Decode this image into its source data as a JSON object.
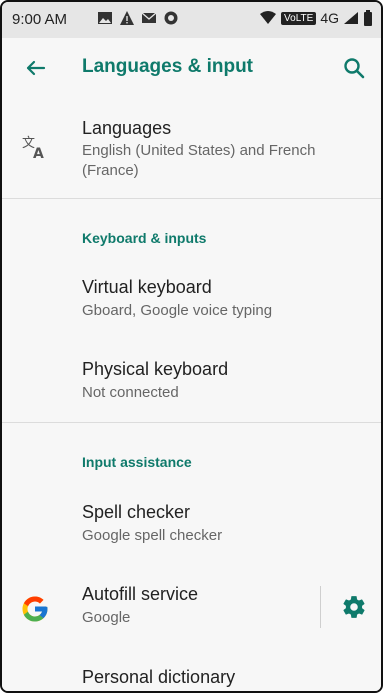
{
  "status_bar": {
    "time": "9:00 AM",
    "icons_left": [
      "image-icon",
      "warning-icon",
      "mail-icon",
      "shield-icon"
    ],
    "volte": "VoLTE",
    "network": "4G",
    "icons_right": [
      "wifi-icon",
      "signal-icon",
      "battery-icon"
    ]
  },
  "app_bar": {
    "title": "Languages & input",
    "back_icon": "arrow-back-icon",
    "search_icon": "search-icon",
    "accent": "#0f7a6b"
  },
  "items": [
    {
      "id": "languages",
      "title": "Languages",
      "summary": "English (United States) and French (France)",
      "icon": "translate-icon"
    },
    {
      "id": "virtual_keyboard",
      "title": "Virtual keyboard",
      "summary": "Gboard, Google voice typing"
    },
    {
      "id": "physical_keyboard",
      "title": "Physical keyboard",
      "summary": "Not connected"
    },
    {
      "id": "spell_checker",
      "title": "Spell checker",
      "summary": "Google spell checker"
    },
    {
      "id": "autofill",
      "title": "Autofill service",
      "summary": "Google",
      "icon": "google-g-icon",
      "action_icon": "gear-icon"
    },
    {
      "id": "personal_dictionary",
      "title": "Personal dictionary",
      "summary": ""
    }
  ],
  "sections": [
    {
      "id": "keyboard_inputs",
      "label": "Keyboard & inputs"
    },
    {
      "id": "input_assistance",
      "label": "Input assistance"
    }
  ]
}
